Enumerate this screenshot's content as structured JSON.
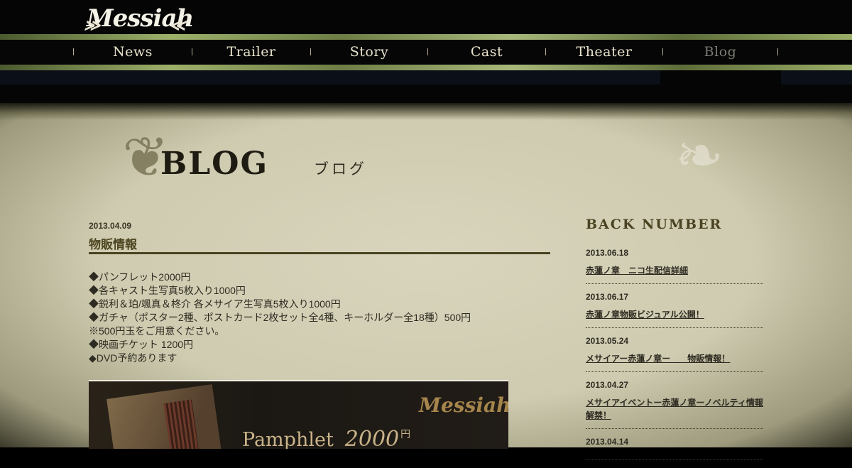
{
  "header": {
    "logo": "Messiah",
    "nav": [
      "News",
      "Trailer",
      "Story",
      "Cast",
      "Theater",
      "Blog"
    ],
    "active_nav": "Blog"
  },
  "page": {
    "title": "BLOG",
    "subtitle": "ブログ"
  },
  "post": {
    "date": "2013.04.09",
    "title": "物販情報",
    "lines": [
      "◆パンフレット2000円",
      "◆各キャスト生写真5枚入り1000円",
      "◆鋭利＆珀/颯真＆柊介 各メサイア生写真5枚入り1000円",
      "◆ガチャ（ポスター2種、ポストカード2枚セット全4種、キーホルダー全18種）500円",
      "※500円玉をご用意ください。",
      "◆映画チケット 1200円",
      "◆DVD予約あります"
    ],
    "banner": {
      "logo": "Messiah",
      "label": "Pamphlet",
      "price": "2000",
      "unit": "円"
    }
  },
  "sidebar": {
    "title": "BACK NUMBER",
    "items": [
      {
        "date": "2013.06.18",
        "title": "赤蓮ノ章　ニコ生配信詳細"
      },
      {
        "date": "2013.06.17",
        "title": "赤蓮ノ章物販ビジュアル公開！"
      },
      {
        "date": "2013.05.24",
        "title": "メサイアー赤蓮ノ章ー　　物販情報！"
      },
      {
        "date": "2013.04.27",
        "title": "メサイアイベントー赤蓮ノ章ーノベルティ情報解禁！"
      },
      {
        "date": "2013.04.14",
        "title": ""
      }
    ]
  }
}
